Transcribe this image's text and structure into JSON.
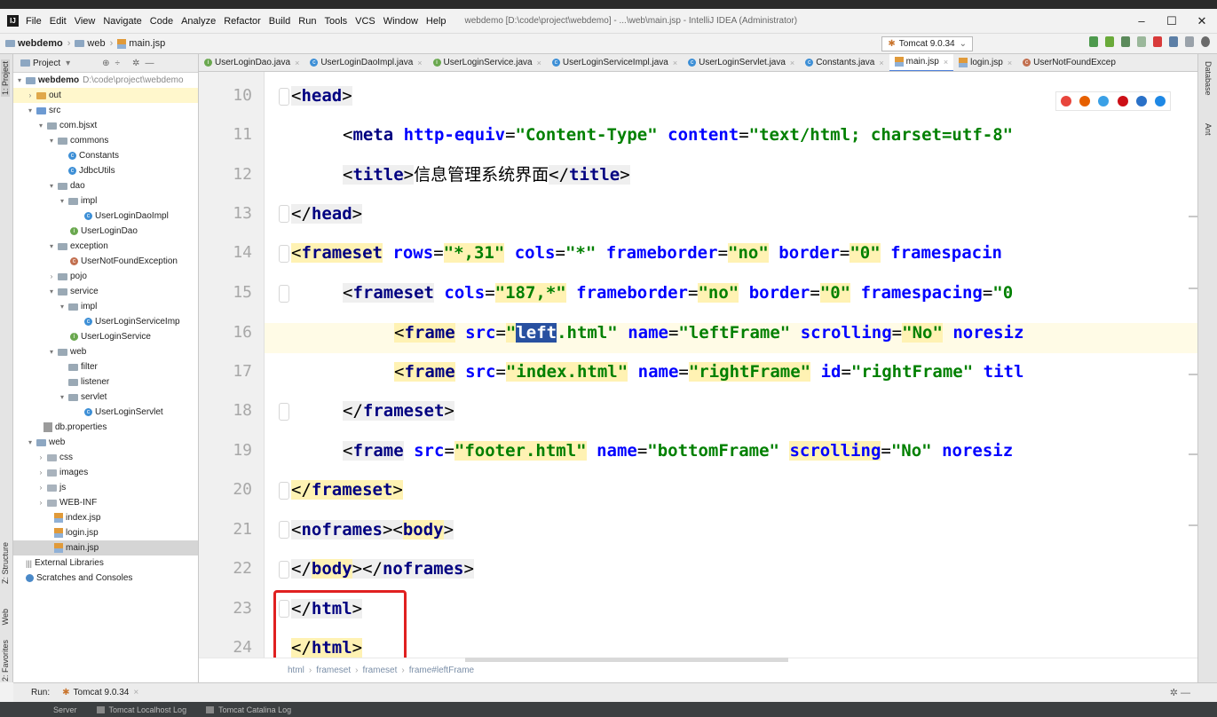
{
  "app": {
    "menu": [
      "File",
      "Edit",
      "View",
      "Navigate",
      "Code",
      "Analyze",
      "Refactor",
      "Build",
      "Run",
      "Tools",
      "VCS",
      "Window",
      "Help"
    ],
    "title": "webdemo [D:\\code\\project\\webdemo] - ...\\web\\main.jsp - IntelliJ IDEA (Administrator)",
    "window_buttons": [
      "–",
      "☐",
      "✕"
    ]
  },
  "nav": {
    "breadcrumb": [
      "webdemo",
      "web",
      "main.jsp"
    ],
    "run_config": "Tomcat 9.0.34"
  },
  "left_strip": {
    "project": "1: Project",
    "structure": "Z: Structure",
    "web": "Web",
    "favorites": "2: Favorites"
  },
  "right_strip": {
    "database": "Database",
    "ant": "Ant"
  },
  "project_panel": {
    "header": "Project",
    "tree": [
      {
        "label": "webdemo",
        "note": "D:\\code\\project\\webdemo"
      },
      {
        "label": "out"
      },
      {
        "label": "src"
      },
      {
        "label": "com.bjsxt"
      },
      {
        "label": "commons"
      },
      {
        "label": "Constants"
      },
      {
        "label": "JdbcUtils"
      },
      {
        "label": "dao"
      },
      {
        "label": "impl"
      },
      {
        "label": "UserLoginDaoImpl"
      },
      {
        "label": "UserLoginDao"
      },
      {
        "label": "exception"
      },
      {
        "label": "UserNotFoundException"
      },
      {
        "label": "pojo"
      },
      {
        "label": "service"
      },
      {
        "label": "impl"
      },
      {
        "label": "UserLoginServiceImp"
      },
      {
        "label": "UserLoginService"
      },
      {
        "label": "web"
      },
      {
        "label": "filter"
      },
      {
        "label": "listener"
      },
      {
        "label": "servlet"
      },
      {
        "label": "UserLoginServlet"
      },
      {
        "label": "db.properties"
      },
      {
        "label": "web"
      },
      {
        "label": "css"
      },
      {
        "label": "images"
      },
      {
        "label": "js"
      },
      {
        "label": "WEB-INF"
      },
      {
        "label": "index.jsp"
      },
      {
        "label": "login.jsp"
      },
      {
        "label": "main.jsp"
      },
      {
        "label": "External Libraries"
      },
      {
        "label": "Scratches and Consoles"
      }
    ]
  },
  "tabs": [
    "UserLoginDao.java",
    "UserLoginDaoImpl.java",
    "UserLoginService.java",
    "UserLoginServiceImpl.java",
    "UserLoginServlet.java",
    "Constants.java",
    "main.jsp",
    "login.jsp",
    "UserNotFoundExcep"
  ],
  "editor": {
    "line_numbers": [
      "10",
      "11",
      "12",
      "13",
      "14",
      "15",
      "16",
      "17",
      "18",
      "19",
      "20",
      "21",
      "22",
      "23",
      "24"
    ],
    "lines": {
      "l10": [
        "<",
        "head",
        ">"
      ],
      "l11": [
        "<",
        "meta",
        " ",
        "http-equiv",
        "=",
        "\"Content-Type\"",
        " ",
        "content",
        "=",
        "\"text/html; charset=utf-8\""
      ],
      "l12": [
        "<",
        "title",
        ">",
        "信息管理系统界面",
        "</",
        "title",
        ">"
      ],
      "l13": [
        "</",
        "head",
        ">"
      ],
      "l14": [
        "<",
        "frameset",
        " ",
        "rows",
        "=",
        "\"*,31\"",
        " ",
        "cols",
        "=",
        "\"*\"",
        " ",
        "frameborder",
        "=",
        "\"no\"",
        " ",
        "border",
        "=",
        "\"0\"",
        " ",
        "framespacin"
      ],
      "l15": [
        "<",
        "frameset",
        " ",
        "cols",
        "=",
        "\"187,*\"",
        " ",
        "frameborder",
        "=",
        "\"no\"",
        " ",
        "border",
        "=",
        "\"0\"",
        " ",
        "framespacing",
        "=",
        "\"0"
      ],
      "l16": [
        "<",
        "frame",
        " ",
        "src",
        "=",
        "\"",
        "left",
        ".html\"",
        " ",
        "name",
        "=",
        "\"leftFrame\"",
        " ",
        "scrolling",
        "=",
        "\"No\"",
        " ",
        "noresiz"
      ],
      "l17": [
        "<",
        "frame",
        " ",
        "src",
        "=",
        "\"index.html\"",
        " ",
        "name",
        "=",
        "\"rightFrame\"",
        " ",
        "id",
        "=",
        "\"rightFrame\"",
        " ",
        "titl"
      ],
      "l18": [
        "</",
        "frameset",
        ">"
      ],
      "l19": [
        "<",
        "frame",
        " ",
        "src",
        "=",
        "\"footer.html\"",
        " ",
        "name",
        "=",
        "\"bottomFrame\"",
        " ",
        "scrolling",
        "=",
        "\"No\"",
        " ",
        "noresiz"
      ],
      "l20": [
        "</",
        "frameset",
        ">"
      ],
      "l21": [
        "<",
        "noframes",
        "><",
        "body",
        ">"
      ],
      "l22": [
        "</",
        "body",
        "></",
        "noframes",
        ">"
      ],
      "l23": [
        "</",
        "html",
        ">"
      ],
      "l24": [
        "</",
        "html",
        ">"
      ]
    }
  },
  "editor_breadcrumb": [
    "html",
    "frameset",
    "frameset",
    "frame#leftFrame"
  ],
  "run_bar": {
    "label": "Run:",
    "config": "Tomcat 9.0.34"
  },
  "bottom_tabs": [
    "Server",
    "Tomcat Localhost Log",
    "Tomcat Catalina Log"
  ]
}
